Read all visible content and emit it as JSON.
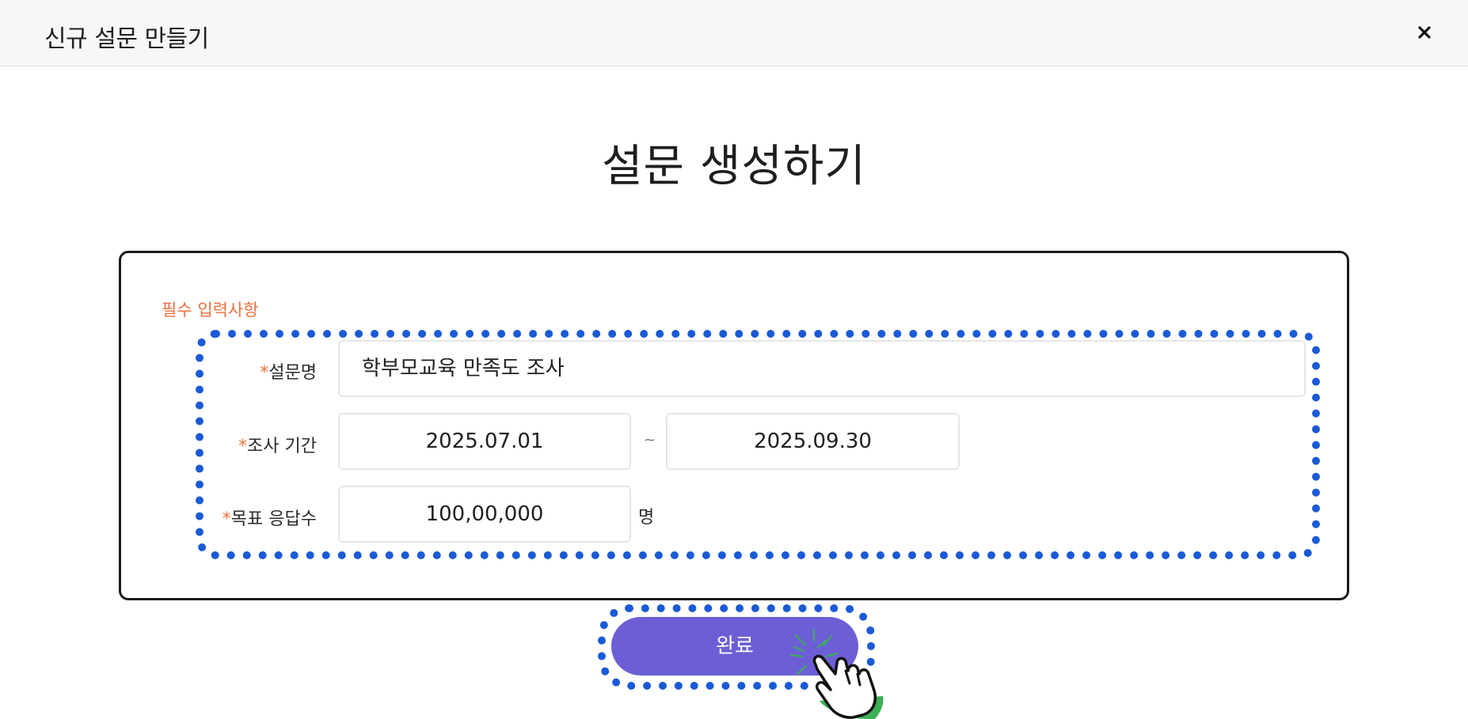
{
  "header": {
    "title": "신규 설문 만들기",
    "close_icon": "close-icon"
  },
  "page": {
    "title": "설문 생성하기"
  },
  "form": {
    "required_note": "필수 입력사항",
    "required_mark": "*",
    "survey_name": {
      "label": "설문명",
      "value": "학부모교육 만족도 조사"
    },
    "period": {
      "label": "조사 기간",
      "start": "2025.07.01",
      "separator": "~",
      "end": "2025.09.30"
    },
    "target": {
      "label": "목표 응답수",
      "value": "100,00,000",
      "unit": "명"
    }
  },
  "actions": {
    "complete_label": "완료"
  },
  "colors": {
    "accent": "#6c5fd6",
    "required": "#f0703e",
    "highlight": "#1a5ad6",
    "click_effect": "#3cb054"
  },
  "icons": {
    "pointer": "hand-pointer-icon"
  }
}
